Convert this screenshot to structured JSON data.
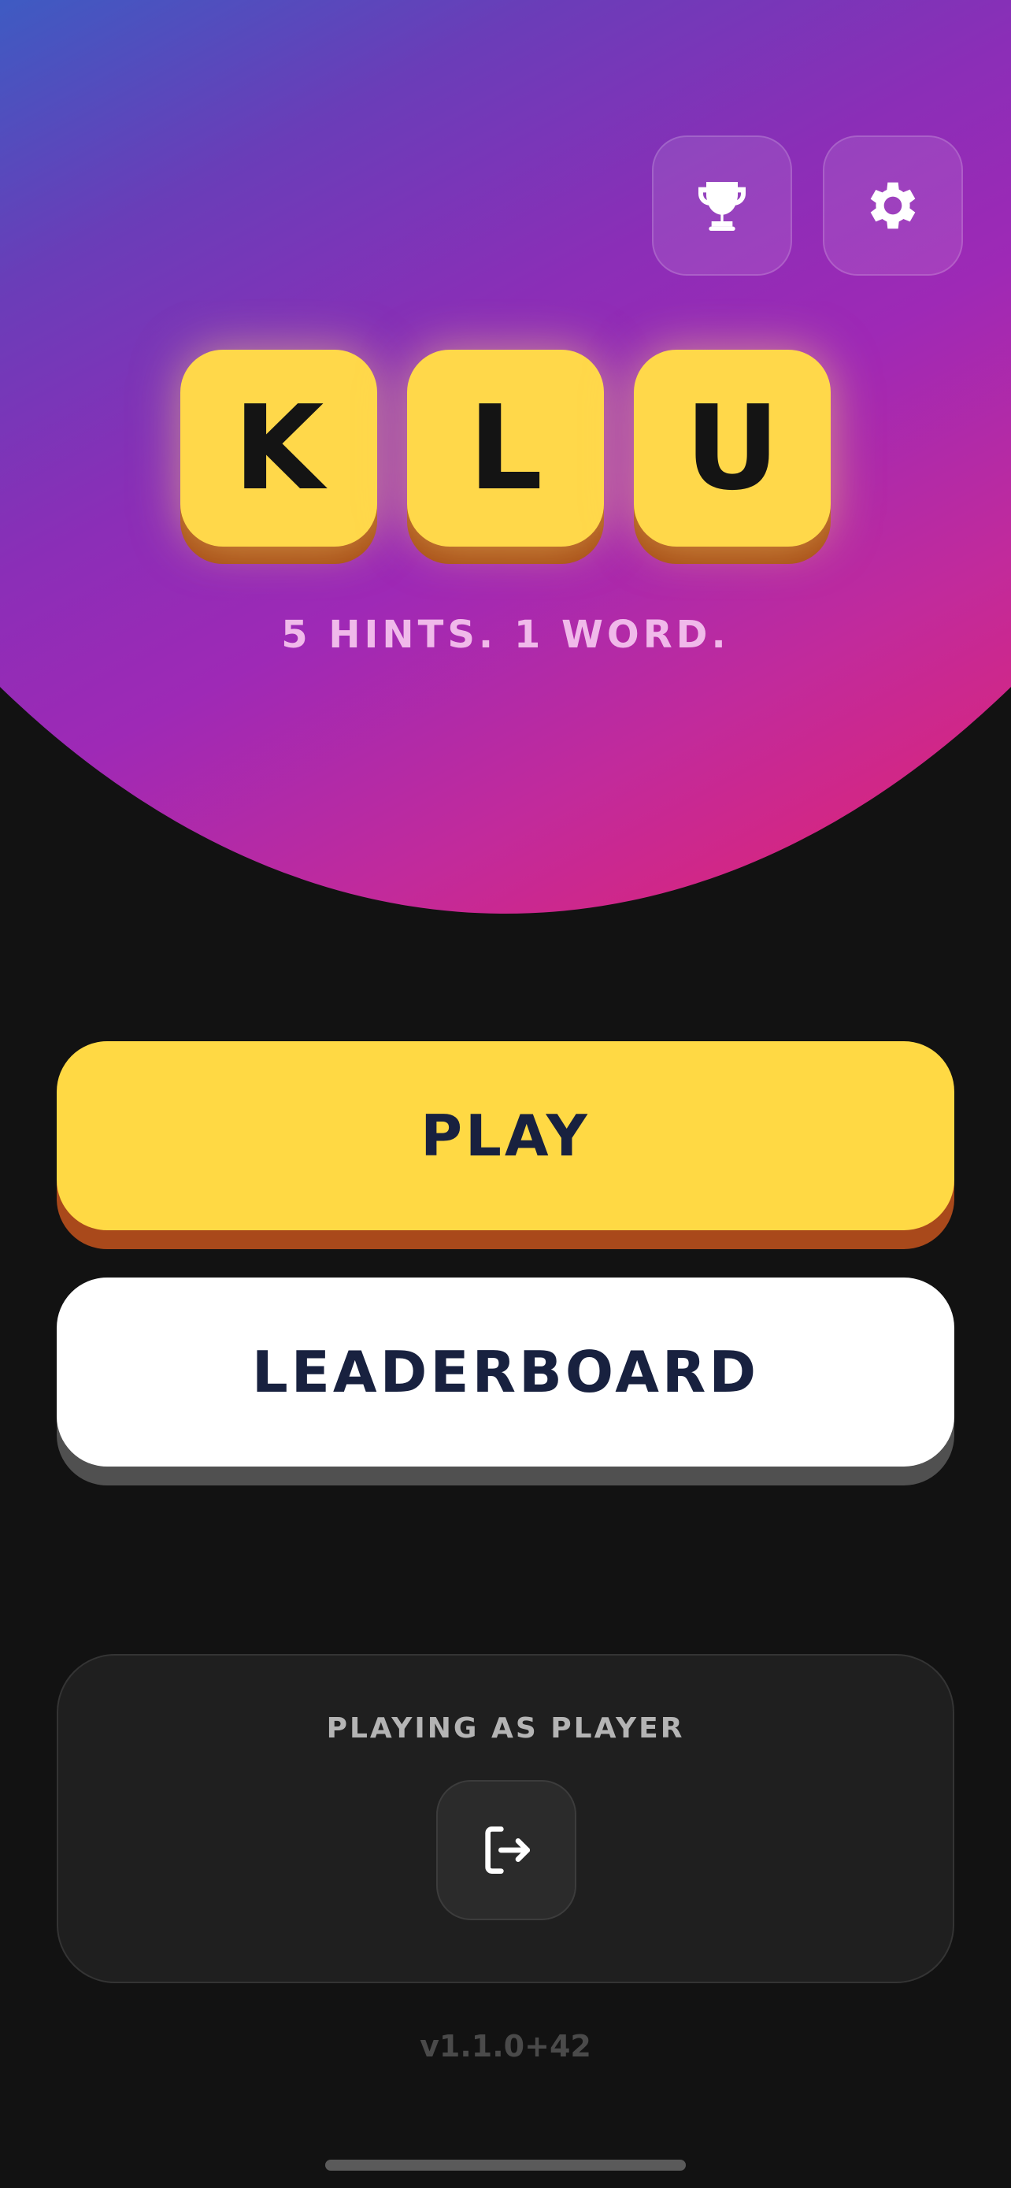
{
  "header": {
    "trophy_icon": "trophy-icon",
    "settings_icon": "gear-icon",
    "gradient_colors": [
      "#3e5bc2",
      "#9e29b6",
      "#e3236f"
    ]
  },
  "logo": {
    "letters": [
      "K",
      "L",
      "U"
    ],
    "tile_color": "#ffd84a"
  },
  "tagline": "5 HINTS. 1 WORD.",
  "buttons": {
    "play_label": "PLAY",
    "leaderboard_label": "LEADERBOARD",
    "play_color": "#ffd944"
  },
  "player": {
    "label": "PLAYING AS PLAYER",
    "logout_icon": "logout-icon"
  },
  "version": "v1.1.0+42"
}
